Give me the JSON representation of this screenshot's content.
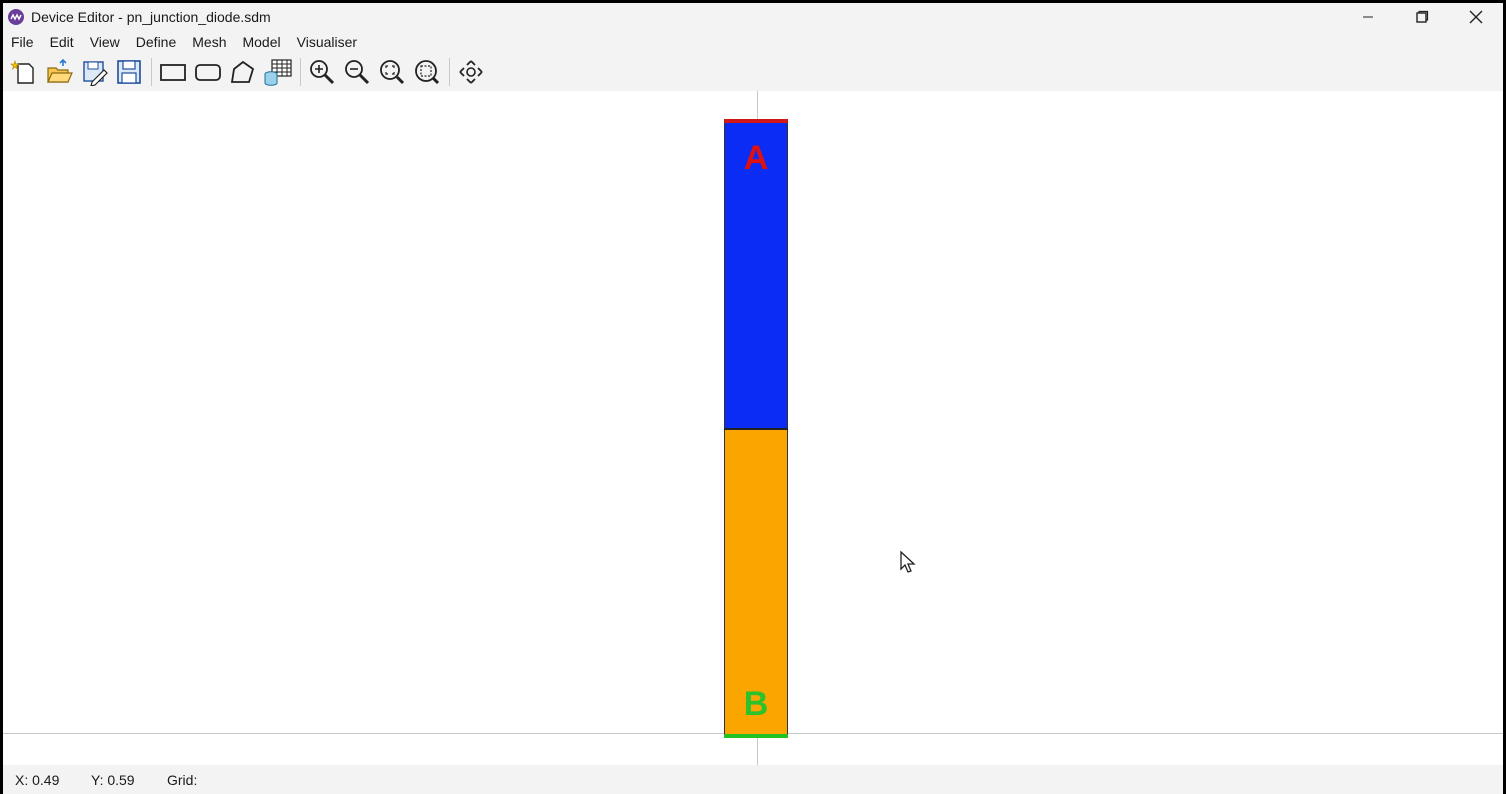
{
  "window": {
    "title": "Device Editor - pn_junction_diode.sdm"
  },
  "menu": [
    "File",
    "Edit",
    "View",
    "Define",
    "Mesh",
    "Model",
    "Visualiser"
  ],
  "toolbar": {
    "icons": [
      "new-file-icon",
      "open-folder-icon",
      "save-as-icon",
      "save-icon",
      "rectangle-icon",
      "rounded-rectangle-icon",
      "polygon-icon",
      "database-grid-icon",
      "zoom-in-icon",
      "zoom-out-icon",
      "zoom-fit-icon",
      "zoom-reset-icon",
      "pan-icon"
    ]
  },
  "canvas": {
    "region_a": {
      "label": "A",
      "color": "#0a2cf5",
      "label_color": "#e01010"
    },
    "region_b": {
      "label": "B",
      "color": "#faa500",
      "label_color": "#2bc22b"
    },
    "contact_top_color": "#d11818",
    "contact_bottom_color": "#22c222"
  },
  "status": {
    "x": "X: 0.49",
    "y": "Y: 0.59",
    "grid": "Grid:"
  }
}
